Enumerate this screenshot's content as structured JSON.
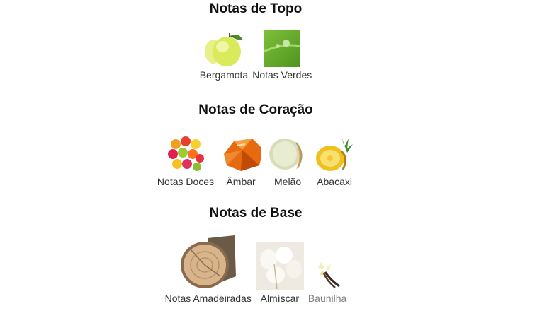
{
  "sections": {
    "top": {
      "title": "Notas de Topo",
      "notes": [
        {
          "label": "Bergamota",
          "icon": "bergamot-image"
        },
        {
          "label": "Notas Verdes",
          "icon": "green-notes-image"
        }
      ]
    },
    "heart": {
      "title": "Notas de Coração",
      "notes": [
        {
          "label": "Notas Doces",
          "icon": "sweet-notes-image"
        },
        {
          "label": "Âmbar",
          "icon": "amber-image"
        },
        {
          "label": "Melão",
          "icon": "melon-image"
        },
        {
          "label": "Abacaxi",
          "icon": "pineapple-image"
        }
      ]
    },
    "base": {
      "title": "Notas de Base",
      "notes": [
        {
          "label": "Notas Amadeiradas",
          "icon": "woody-notes-image"
        },
        {
          "label": "Almíscar",
          "icon": "musk-image"
        },
        {
          "label": "Baunilha",
          "icon": "vanilla-image"
        }
      ]
    }
  },
  "colors": {
    "title": "#111111",
    "label": "#333333",
    "faded_label": "#808080",
    "background": "#ffffff"
  }
}
